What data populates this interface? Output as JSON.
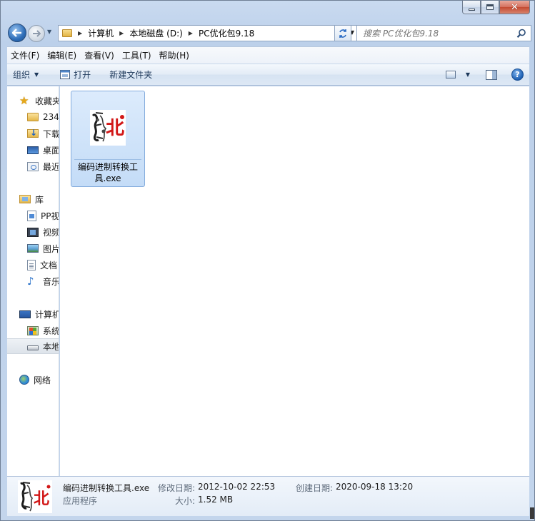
{
  "window": {
    "controls": {
      "minimize": "minimize",
      "maximize": "maximize",
      "close": "close"
    }
  },
  "address": {
    "crumbs": [
      "计算机",
      "本地磁盘 (D:)",
      "PC优化包9.18"
    ]
  },
  "search": {
    "placeholder": "搜索 PC优化包9.18"
  },
  "menu": [
    "文件(F)",
    "编辑(E)",
    "查看(V)",
    "工具(T)",
    "帮助(H)"
  ],
  "commands": {
    "organize": "组织",
    "open": "打开",
    "new_folder": "新建文件夹"
  },
  "nav": {
    "favorites": "收藏夹",
    "fav_items": [
      "234",
      "下载",
      "桌面",
      "最近访问的位置"
    ],
    "libraries": "库",
    "lib_items": [
      "PP视频",
      "视频",
      "图片",
      "文档",
      "音乐"
    ],
    "computer": "计算机",
    "comp_items": [
      "系统 (C:)",
      "本地磁盘 (D:)"
    ],
    "network": "网络"
  },
  "files": [
    {
      "name": "编码进制转换工具.exe",
      "icon": "exe-app-icon",
      "badge_text": "北"
    }
  ],
  "details": {
    "file_name": "编码进制转换工具.exe",
    "file_type": "应用程序",
    "modified_label": "修改日期:",
    "modified_value": "2012-10-02 22:53",
    "created_label": "创建日期:",
    "created_value": "2020-09-18 13:20",
    "size_label": "大小:",
    "size_value": "1.52 MB"
  },
  "colors": {
    "accent_red": "#d21818",
    "selection": "#cce0f8",
    "nav_text": "#1e395b"
  }
}
